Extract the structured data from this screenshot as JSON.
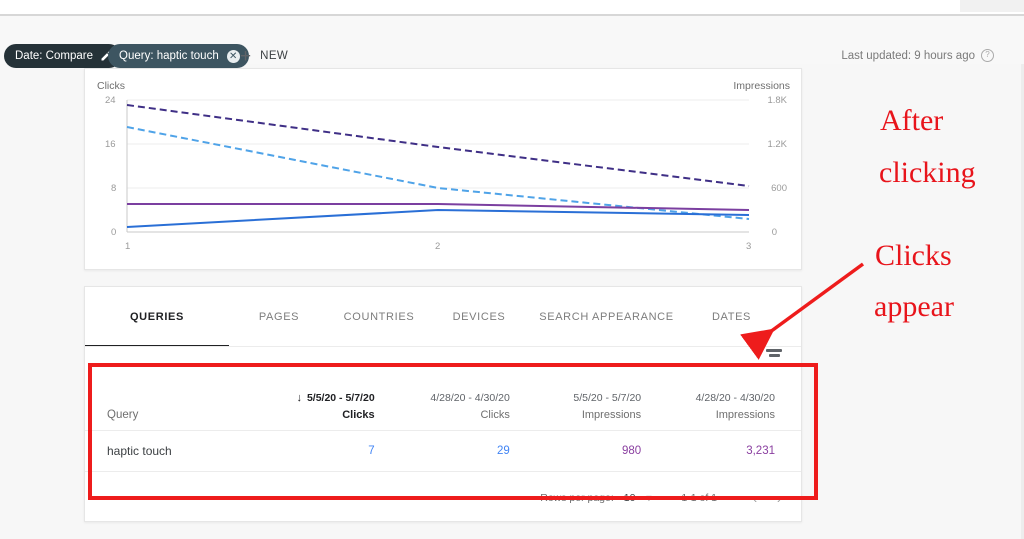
{
  "filter_bar": {
    "chips": [
      {
        "label": "Date: Compare",
        "icon": "pencil-icon",
        "has_close": false
      },
      {
        "label": "Query: haptic touch",
        "icon": "close-icon",
        "has_close": true
      }
    ],
    "new_button": {
      "plus": "+",
      "label": "NEW"
    },
    "last_updated": "Last updated: 9 hours ago",
    "help_icon": "?"
  },
  "chart_data": {
    "type": "line",
    "title": "",
    "ylabel": "Clicks",
    "y2label": "Impressions",
    "xlabel": "",
    "x": [
      "1",
      "2",
      "3"
    ],
    "xticks": [
      "1",
      "2",
      "3"
    ],
    "yticks": [
      "0",
      "8",
      "16",
      "24"
    ],
    "ylim": [
      0,
      24
    ],
    "y2ticks": [
      "0",
      "600",
      "1.2K",
      "1.8K"
    ],
    "y2lim": [
      0,
      1800
    ],
    "grid": true,
    "legend": "none",
    "series": [
      {
        "name": "Impressions 5/5/20 - 5/7/20",
        "axis": "right",
        "style": "dashed",
        "color": "#3f2f86",
        "values": [
          1730,
          1160,
          620
        ]
      },
      {
        "name": "Impressions 4/28/20 - 4/30/20",
        "axis": "right",
        "style": "dashed",
        "color": "#4fa3e8",
        "values": [
          1430,
          600,
          175
        ]
      },
      {
        "name": "Clicks 5/5/20 - 5/7/20",
        "axis": "left",
        "style": "solid",
        "color": "#7b3fa0",
        "values": [
          5,
          5,
          4.2
        ]
      },
      {
        "name": "Clicks 4/28/20 - 4/30/20",
        "axis": "left",
        "style": "solid",
        "color": "#2a6fd6",
        "values": [
          1,
          4.2,
          3.4
        ]
      }
    ]
  },
  "tabs": [
    {
      "label": "QUERIES",
      "active": true
    },
    {
      "label": "PAGES",
      "active": false
    },
    {
      "label": "COUNTRIES",
      "active": false
    },
    {
      "label": "DEVICES",
      "active": false
    },
    {
      "label": "SEARCH APPEARANCE",
      "active": false
    },
    {
      "label": "DATES",
      "active": false
    }
  ],
  "table": {
    "filter_icon": "filter-list-icon",
    "sort_arrow": "↓",
    "columns": [
      {
        "date": "",
        "metric": "Query",
        "sorted": false
      },
      {
        "date": "5/5/20 - 5/7/20",
        "metric": "Clicks",
        "sorted": true
      },
      {
        "date": "4/28/20 - 4/30/20",
        "metric": "Clicks",
        "sorted": false
      },
      {
        "date": "5/5/20 - 5/7/20",
        "metric": "Impressions",
        "sorted": false
      },
      {
        "date": "4/28/20 - 4/30/20",
        "metric": "Impressions",
        "sorted": false
      }
    ],
    "rows": [
      {
        "query": "haptic touch",
        "clicks_current": "7",
        "clicks_previous": "29",
        "impressions_current": "980",
        "impressions_previous": "3,231"
      }
    ],
    "pagination": {
      "rows_per_page_label": "Rows per page:",
      "rows_per_page_value": "10",
      "caret": "▼",
      "range": "1-1 of 1",
      "prev": "‹",
      "next": "›"
    }
  },
  "annotations": {
    "line1": "After",
    "line2": "clicking",
    "line3": "Clicks",
    "line4": "appear",
    "color": "#e8141b",
    "highlight_color": "#ee1c1c"
  }
}
